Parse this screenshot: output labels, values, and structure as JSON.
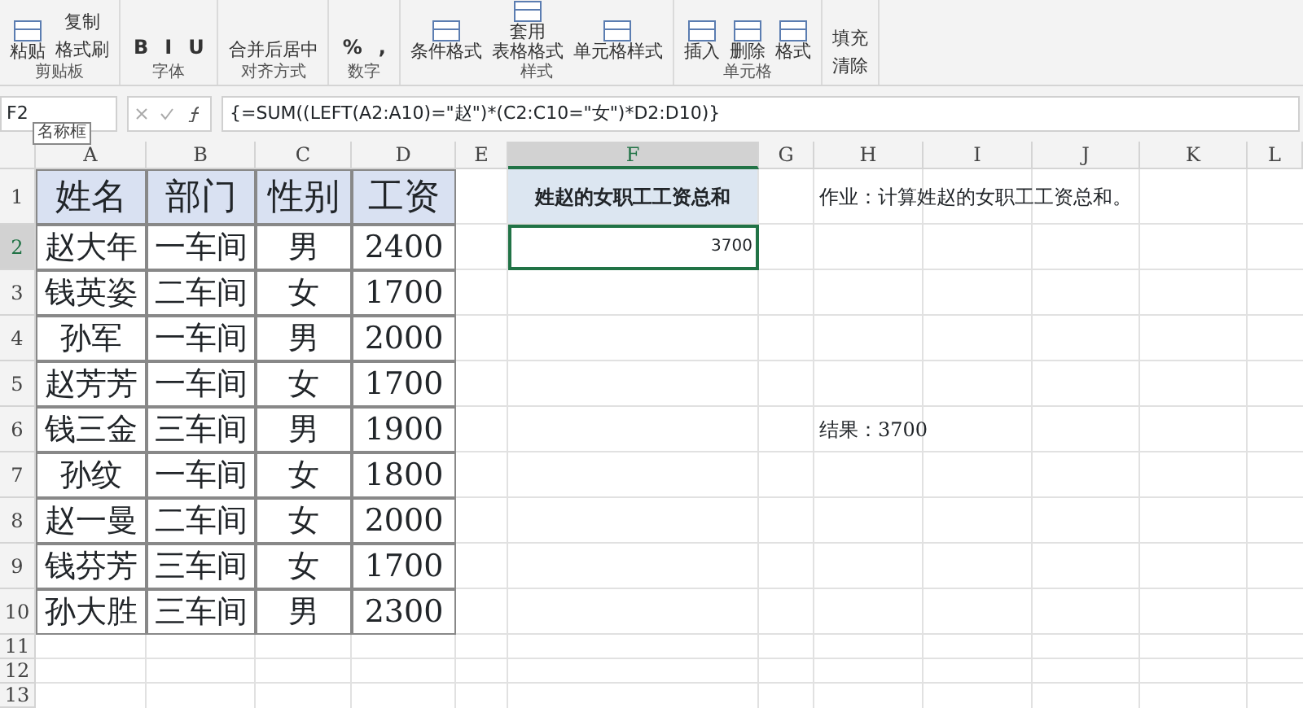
{
  "ribbon": {
    "groups": [
      {
        "label": "剪贴板",
        "items": [
          {
            "text": "粘贴",
            "kind": "big"
          },
          {
            "text": "复制",
            "kind": "small"
          },
          {
            "text": "格式刷",
            "kind": "small"
          }
        ]
      },
      {
        "label": "字体",
        "items": [
          {
            "text": "B",
            "kind": "glyph"
          },
          {
            "text": "I",
            "kind": "glyph"
          },
          {
            "text": "U",
            "kind": "glyph"
          }
        ]
      },
      {
        "label": "对齐方式",
        "items": [
          {
            "text": "合并后居中",
            "kind": "small"
          }
        ]
      },
      {
        "label": "数字",
        "items": [
          {
            "text": "%",
            "kind": "glyph"
          },
          {
            "text": ",",
            "kind": "glyph"
          }
        ]
      },
      {
        "label": "样式",
        "items": [
          {
            "text": "条件格式",
            "kind": "big"
          },
          {
            "lines": [
              "套用",
              "表格格式"
            ],
            "kind": "big"
          },
          {
            "text": "单元格样式",
            "kind": "big"
          }
        ]
      },
      {
        "label": "单元格",
        "items": [
          {
            "text": "插入",
            "kind": "big"
          },
          {
            "text": "删除",
            "kind": "big"
          },
          {
            "text": "格式",
            "kind": "big"
          }
        ]
      },
      {
        "items": [
          {
            "text": "填充",
            "kind": "small"
          },
          {
            "text": "清除",
            "kind": "small"
          }
        ]
      }
    ]
  },
  "formula_bar": {
    "name_box": "F2",
    "formula": "{=SUM((LEFT(A2:A10)=\"赵\")*(C2:C10=\"女\")*D2:D10)}",
    "tooltip": "名称框"
  },
  "sheet": {
    "columns": [
      {
        "label": "A",
        "selected": false
      },
      {
        "label": "B",
        "selected": false
      },
      {
        "label": "C",
        "selected": false
      },
      {
        "label": "D",
        "selected": false
      },
      {
        "label": "E",
        "selected": false
      },
      {
        "label": "F",
        "selected": true
      },
      {
        "label": "G",
        "selected": false
      },
      {
        "label": "H",
        "selected": false
      },
      {
        "label": "I",
        "selected": false
      },
      {
        "label": "J",
        "selected": false
      },
      {
        "label": "K",
        "selected": false
      },
      {
        "label": "L",
        "selected": false
      }
    ],
    "rows": [
      {
        "number": "1",
        "selected": false,
        "cells": [
          {
            "text": "姓名",
            "kind": "header"
          },
          {
            "text": "部门",
            "kind": "header"
          },
          {
            "text": "性别",
            "kind": "header"
          },
          {
            "text": "工资",
            "kind": "header"
          },
          null,
          {
            "text": "姓赵的女职工工资总和",
            "kind": "label"
          },
          null,
          {
            "text": "作业：计算姓赵的女职工工资总和。",
            "kind": "note"
          }
        ]
      },
      {
        "number": "2",
        "selected": true,
        "cells": [
          {
            "text": "赵大年",
            "kind": "data"
          },
          {
            "text": "一车间",
            "kind": "data"
          },
          {
            "text": "男",
            "kind": "data"
          },
          {
            "text": "2400",
            "kind": "data"
          },
          null,
          {
            "text": "3700",
            "kind": "value",
            "selected": true
          }
        ]
      },
      {
        "number": "3",
        "selected": false,
        "cells": [
          {
            "text": "钱英姿",
            "kind": "data"
          },
          {
            "text": "二车间",
            "kind": "data"
          },
          {
            "text": "女",
            "kind": "data"
          },
          {
            "text": "1700",
            "kind": "data"
          }
        ]
      },
      {
        "number": "4",
        "selected": false,
        "cells": [
          {
            "text": "孙军",
            "kind": "data"
          },
          {
            "text": "一车间",
            "kind": "data"
          },
          {
            "text": "男",
            "kind": "data"
          },
          {
            "text": "2000",
            "kind": "data"
          }
        ]
      },
      {
        "number": "5",
        "selected": false,
        "cells": [
          {
            "text": "赵芳芳",
            "kind": "data"
          },
          {
            "text": "一车间",
            "kind": "data"
          },
          {
            "text": "女",
            "kind": "data"
          },
          {
            "text": "1700",
            "kind": "data"
          }
        ]
      },
      {
        "number": "6",
        "selected": false,
        "cells": [
          {
            "text": "钱三金",
            "kind": "data"
          },
          {
            "text": "三车间",
            "kind": "data"
          },
          {
            "text": "男",
            "kind": "data"
          },
          {
            "text": "1900",
            "kind": "data"
          },
          null,
          null,
          null,
          {
            "text": "结果：3700",
            "kind": "note"
          }
        ]
      },
      {
        "number": "7",
        "selected": false,
        "cells": [
          {
            "text": "孙纹",
            "kind": "data"
          },
          {
            "text": "一车间",
            "kind": "data"
          },
          {
            "text": "女",
            "kind": "data"
          },
          {
            "text": "1800",
            "kind": "data"
          }
        ]
      },
      {
        "number": "8",
        "selected": false,
        "cells": [
          {
            "text": "赵一曼",
            "kind": "data"
          },
          {
            "text": "二车间",
            "kind": "data"
          },
          {
            "text": "女",
            "kind": "data"
          },
          {
            "text": "2000",
            "kind": "data"
          }
        ]
      },
      {
        "number": "9",
        "selected": false,
        "cells": [
          {
            "text": "钱芬芳",
            "kind": "data"
          },
          {
            "text": "三车间",
            "kind": "data"
          },
          {
            "text": "女",
            "kind": "data"
          },
          {
            "text": "1700",
            "kind": "data"
          }
        ]
      },
      {
        "number": "10",
        "selected": false,
        "cells": [
          {
            "text": "孙大胜",
            "kind": "data"
          },
          {
            "text": "三车间",
            "kind": "data"
          },
          {
            "text": "男",
            "kind": "data"
          },
          {
            "text": "2300",
            "kind": "data"
          }
        ]
      },
      {
        "number": "11",
        "selected": false,
        "cells": []
      },
      {
        "number": "12",
        "selected": false,
        "cells": []
      },
      {
        "number": "13",
        "selected": false,
        "cells": []
      }
    ]
  }
}
